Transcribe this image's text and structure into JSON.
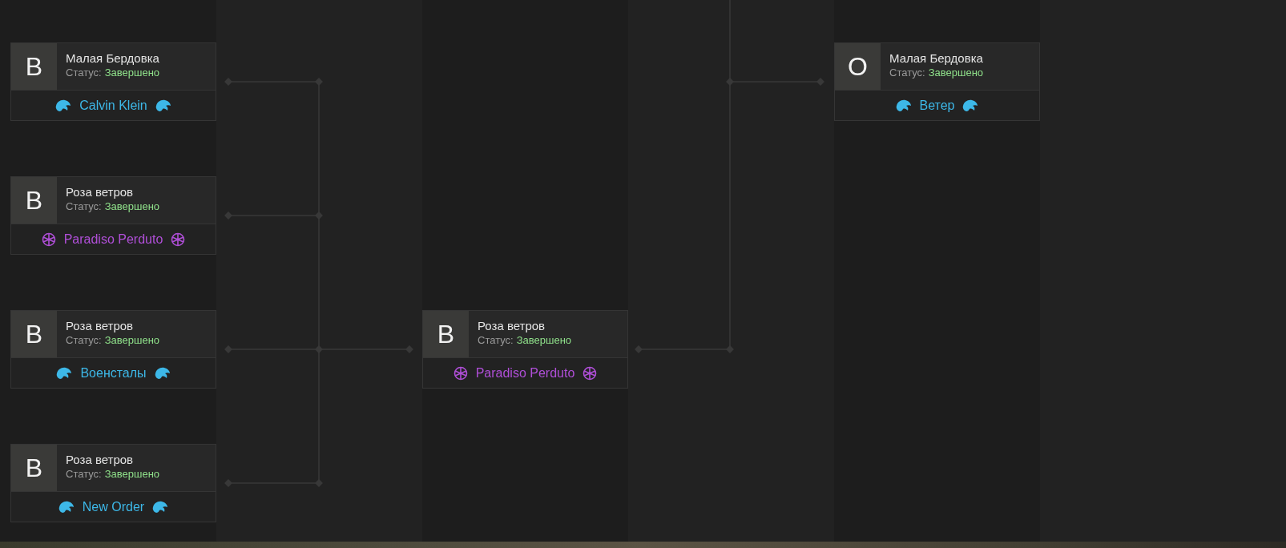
{
  "rounds": [
    {
      "matches": [
        {
          "seed": "В",
          "name": "Малая Бердовка",
          "status_label": "Статус:",
          "status": "Завершено",
          "team": {
            "name": "Calvin Klein",
            "kind": "eagle",
            "color": "#3db8e8"
          }
        },
        {
          "seed": "В",
          "name": "Роза ветров",
          "status_label": "Статус:",
          "status": "Завершено",
          "team": {
            "name": "Paradiso Perduto",
            "kind": "orb",
            "color": "#b04fd8"
          }
        },
        {
          "seed": "В",
          "name": "Роза ветров",
          "status_label": "Статус:",
          "status": "Завершено",
          "team": {
            "name": "Военсталы",
            "kind": "eagle",
            "color": "#3db8e8"
          }
        },
        {
          "seed": "В",
          "name": "Роза ветров",
          "status_label": "Статус:",
          "status": "Завершено",
          "team": {
            "name": "New Order",
            "kind": "eagle",
            "color": "#3db8e8"
          }
        }
      ]
    },
    {
      "matches": [
        {
          "seed": "В",
          "name": "Роза ветров",
          "status_label": "Статус:",
          "status": "Завершено",
          "team": {
            "name": "Paradiso Perduto",
            "kind": "orb",
            "color": "#b04fd8"
          }
        }
      ]
    },
    {
      "matches": [
        {
          "seed": "О",
          "name": "Малая Бердовка",
          "status_label": "Статус:",
          "status": "Завершено",
          "team": {
            "name": "Ветер",
            "kind": "eagle",
            "color": "#3db8e8"
          }
        }
      ]
    }
  ]
}
